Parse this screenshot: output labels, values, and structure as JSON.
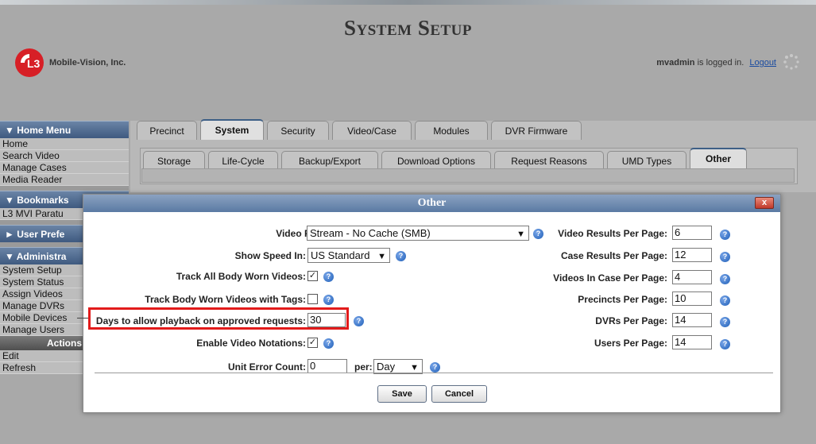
{
  "header": {
    "title": "System Setup",
    "company": "Mobile-Vision, Inc.",
    "logo_text": "L3",
    "user": "mvadmin",
    "logged_in_suffix": "is logged in.",
    "logout": "Logout"
  },
  "sidebar": {
    "home_menu": "▼ Home Menu",
    "home_items": [
      "Home",
      "Search Video",
      "Manage Cases",
      "Media Reader"
    ],
    "bookmarks": "▼ Bookmarks",
    "bookmark_items": [
      "L3 MVI Paratu"
    ],
    "user_prefs": "► User Prefe",
    "admin": "▼ Administra",
    "admin_items": [
      "System Setup",
      "System Status",
      "Assign Videos",
      "Manage DVRs",
      "Mobile Devices",
      "Manage Users"
    ],
    "actions": "Actions",
    "action_items": [
      "Edit",
      "Refresh"
    ]
  },
  "tabs": [
    "Precinct",
    "System",
    "Security",
    "Video/Case",
    "Modules",
    "DVR Firmware"
  ],
  "subtabs": [
    "Storage",
    "Life-Cycle",
    "Backup/Export",
    "Download Options",
    "Request Reasons",
    "UMD Types",
    "Other"
  ],
  "dialog": {
    "title": "Other",
    "close": "x",
    "left": {
      "playback_label": "Video Playback Method:",
      "playback_value": "Stream - No Cache (SMB)",
      "speed_label": "Show Speed In:",
      "speed_value": "US Standard",
      "track_all_label": "Track All Body Worn Videos:",
      "track_all_checked": "✓",
      "track_tags_label": "Track Body Worn Videos with Tags:",
      "days_label": "Days to allow playback on approved requests:",
      "days_value": "30",
      "notations_label": "Enable Video Notations:",
      "notations_checked": "✓",
      "unit_error_label": "Unit Error Count:",
      "unit_error_value": "0",
      "per_label": "per:",
      "per_value": "Day"
    },
    "right": {
      "video_results_label": "Video Results Per Page:",
      "video_results_value": "6",
      "case_results_label": "Case Results Per Page:",
      "case_results_value": "12",
      "videos_in_case_label": "Videos In Case Per Page:",
      "videos_in_case_value": "4",
      "precincts_label": "Precincts Per Page:",
      "precincts_value": "10",
      "dvrs_label": "DVRs Per Page:",
      "dvrs_value": "14",
      "users_label": "Users Per Page:",
      "users_value": "14"
    },
    "save": "Save",
    "cancel": "Cancel"
  },
  "colors": {
    "accent": "#3d5f86",
    "highlight": "#e21b1b",
    "help": "#1e5fb8"
  }
}
